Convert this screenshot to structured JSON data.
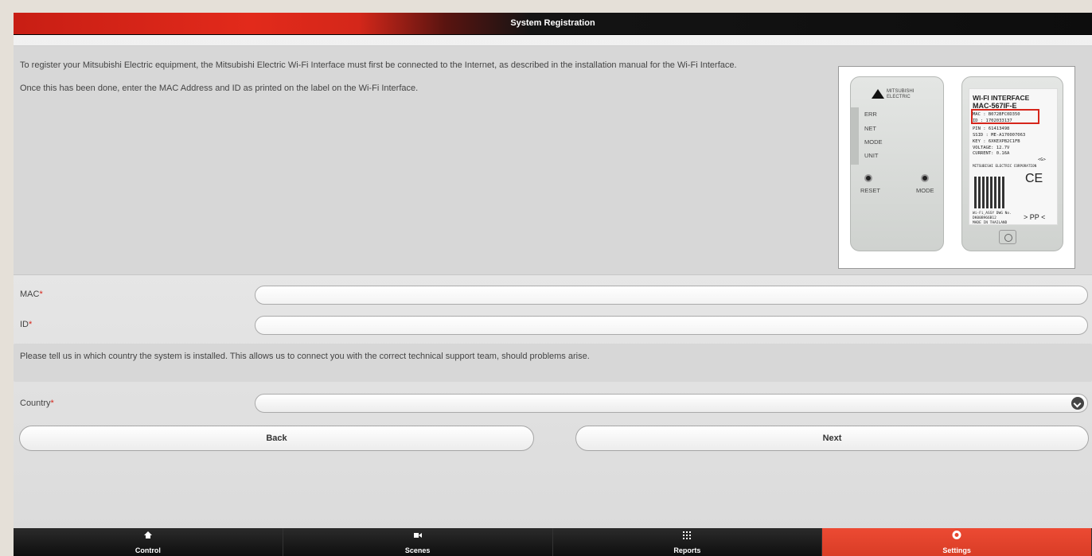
{
  "window": {
    "title": "System Registration"
  },
  "info": {
    "paragraph1": "To register your Mitsubishi Electric equipment, the Mitsubishi Electric Wi-Fi Interface must first be connected to the Internet, as described in the installation manual for the Wi-Fi Interface.",
    "paragraph2": "Once this has been done, enter the MAC Address and ID as printed on the label on the Wi-Fi Interface."
  },
  "device_image": {
    "brand_line1": "MITSUBISHI",
    "brand_line2": "ELECTRIC",
    "leds": [
      "ERR",
      "NET",
      "MODE",
      "UNIT"
    ],
    "buttons": [
      "RESET",
      "MODE"
    ],
    "label": {
      "title": "WI-FI INTERFACE",
      "model": "MAC-567IF-E",
      "mac": "MAC : B072BFC0D350",
      "id": "ID : 1702033137",
      "pin": "PIN : 61413498",
      "ssid": "SSID : ME-A170007063",
      "key": "KEY : 6XKEXPB2C1FB",
      "voltage": "VOLTAGE: 12.7V",
      "current": "CURRENT: 0.16A",
      "corp": "MITSUBISHI ELECTRIC CORPORATION",
      "g_mark": "<G>",
      "ce_mark": "CE",
      "assy": "Wi-Fi_ASSY DWG No.",
      "dwg": "DK00B966B12",
      "made": "MADE IN THAILAND",
      "pp_mark": "> PP <"
    }
  },
  "form": {
    "mac_label": "MAC",
    "mac_value": "",
    "id_label": "ID",
    "id_value": "",
    "required_marker": "*",
    "country_info": "Please tell us in which country the system is installed. This allows us to connect you with the correct technical support team, should problems arise.",
    "country_label": "Country",
    "country_value": ""
  },
  "buttons": {
    "back": "Back",
    "next": "Next"
  },
  "tabs": [
    {
      "label": "Control",
      "icon": "home-icon",
      "active": false
    },
    {
      "label": "Scenes",
      "icon": "camera-icon",
      "active": false
    },
    {
      "label": "Reports",
      "icon": "grid-icon",
      "active": false
    },
    {
      "label": "Settings",
      "icon": "gear-icon",
      "active": true
    }
  ],
  "colors": {
    "accent": "#d93d26",
    "required": "#d6261b",
    "titlebar_dark": "#0d0d0d"
  }
}
